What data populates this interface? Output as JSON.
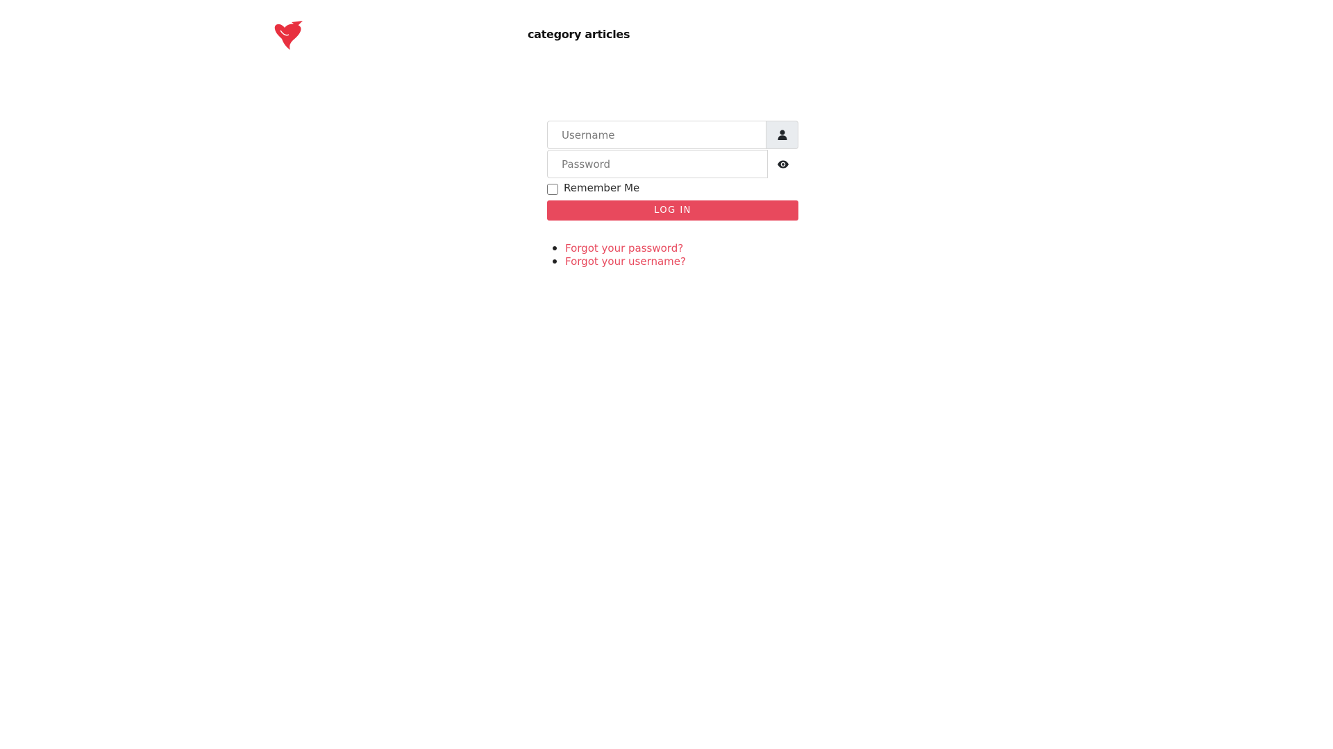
{
  "header": {
    "title": "category articles",
    "logo_icon": "red-heart-figure-logo-icon",
    "brand_color": "#e8495d"
  },
  "login": {
    "username_placeholder": "Username",
    "password_placeholder": "Password",
    "username_icon": "user-icon",
    "password_toggle_icon": "eye-icon",
    "remember_label": "Remember Me",
    "remember_checked": false,
    "login_button_label": "LOG IN"
  },
  "links": {
    "forgot_password": "Forgot your password?",
    "forgot_username": "Forgot your username?"
  }
}
